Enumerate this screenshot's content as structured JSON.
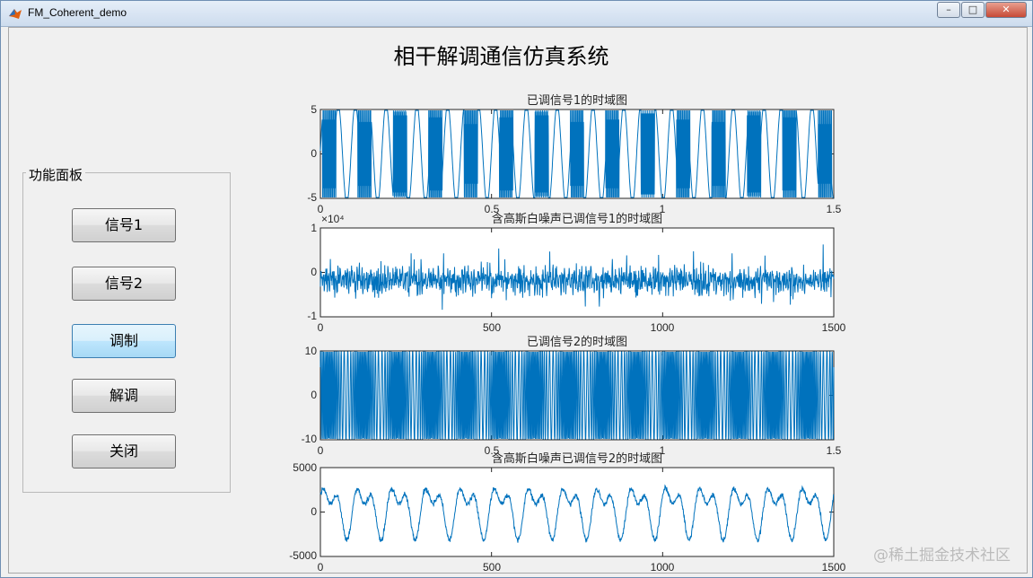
{
  "window": {
    "title": "FM_Coherent_demo",
    "controls": {
      "minimize": "–",
      "maximize": "□",
      "close": "✕"
    }
  },
  "app_title": "相干解调通信仿真系统",
  "panel": {
    "title": "功能面板",
    "buttons": [
      {
        "label": "信号1",
        "active": false
      },
      {
        "label": "信号2",
        "active": false
      },
      {
        "label": "调制",
        "active": true
      },
      {
        "label": "解调",
        "active": false
      },
      {
        "label": "关闭",
        "active": false
      }
    ]
  },
  "watermark": "@稀土掘金技术社区",
  "colors": {
    "line": "#0072bd",
    "axes": "#262626",
    "background": "#f0f0f0"
  },
  "chart_data": [
    {
      "type": "line",
      "title": "已调信号1的时域图",
      "xlim": [
        0,
        1.5
      ],
      "ylim": [
        -5,
        5
      ],
      "xticks": [
        "0",
        "0.5",
        "1",
        "1.5"
      ],
      "yticks": [
        "5",
        "0",
        "-5"
      ],
      "description_of_series": "FM signal, amplitude 5, bursts of high-frequency oscillation separated by slow segments",
      "series": [
        {
          "amplitude": 5,
          "bursts_per_unit": 10
        }
      ]
    },
    {
      "type": "line",
      "title": "含高斯白噪声已调信号1的时域图",
      "xlim": [
        0,
        1500
      ],
      "ylim": [
        -1,
        1
      ],
      "y_exponent": "×10⁴",
      "xticks": [
        "0",
        "500",
        "1000",
        "1500"
      ],
      "yticks": [
        "1",
        "0",
        "-1"
      ],
      "series": [
        {
          "noise_mean": -0.2,
          "noise_spread": 0.35
        }
      ]
    },
    {
      "type": "line",
      "title": "已调信号2的时域图",
      "xlim": [
        0,
        1.5
      ],
      "ylim": [
        -10,
        10
      ],
      "xticks": [
        "0",
        "0.5",
        "1",
        "1.5"
      ],
      "yticks": [
        "10",
        "0",
        "-10"
      ],
      "series": [
        {
          "amplitude": 10
        }
      ]
    },
    {
      "type": "line",
      "title": "含高斯白噪声已调信号2的时域图",
      "xlim": [
        0,
        1500
      ],
      "ylim": [
        -5000,
        5000
      ],
      "xticks": [
        "0",
        "500",
        "1000",
        "1500"
      ],
      "yticks": [
        "5000",
        "0",
        "-5000"
      ],
      "series": [
        {
          "periods": 15,
          "amplitude": 3500
        }
      ]
    }
  ]
}
